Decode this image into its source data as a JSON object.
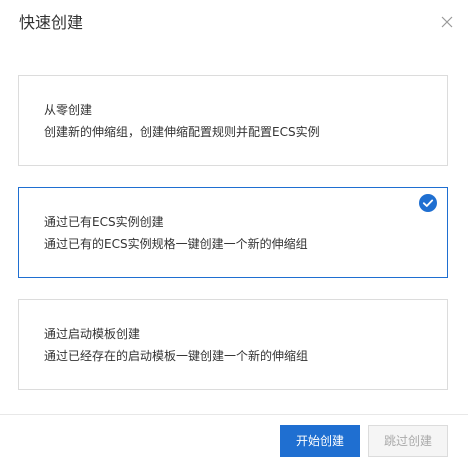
{
  "dialog": {
    "title": "快速创建",
    "close_icon": "close-icon"
  },
  "options": [
    {
      "title": "从零创建",
      "description": "创建新的伸缩组，创建伸缩配置规则并配置ECS实例",
      "selected": false
    },
    {
      "title": "通过已有ECS实例创建",
      "description": "通过已有的ECS实例规格一键创建一个新的伸缩组",
      "selected": true
    },
    {
      "title": "通过启动模板创建",
      "description": "通过已经存在的启动模板一键创建一个新的伸缩组",
      "selected": false
    }
  ],
  "footer": {
    "primary_label": "开始创建",
    "secondary_label": "跳过创建"
  },
  "colors": {
    "accent": "#1f6fd1",
    "border": "#dcdcdc",
    "text": "#333333"
  }
}
